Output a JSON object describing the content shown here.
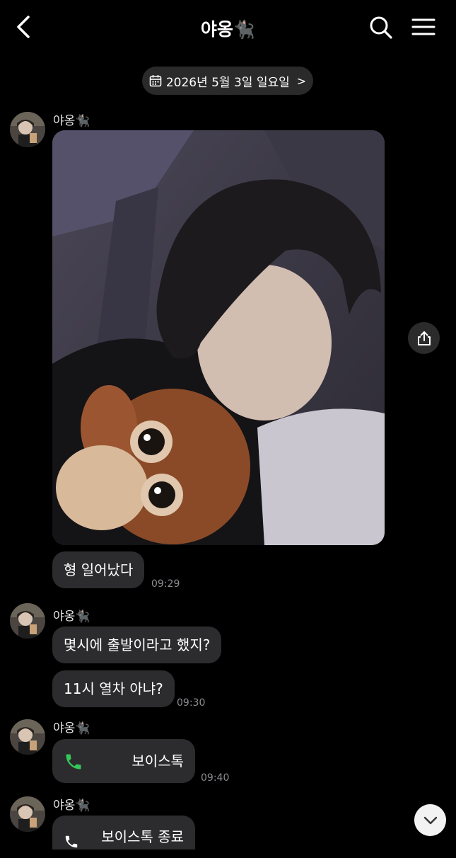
{
  "header": {
    "title": "야옹🐈‍⬛"
  },
  "date_divider": {
    "text": "2026년 5월 3일 일요일",
    "chevron": ">"
  },
  "messages": {
    "group1": {
      "sender": "야옹🐈‍⬛",
      "text": "형 일어났다",
      "time": "09:29"
    },
    "group2": {
      "sender": "야옹🐈‍⬛",
      "text1": "몇시에 출발이라고 했지?",
      "text2": "11시 열차 아냐?",
      "time": "09:30"
    },
    "group3": {
      "sender": "야옹🐈‍⬛",
      "voice_label": "보이스톡",
      "time": "09:40"
    },
    "group4": {
      "sender": "야옹🐈‍⬛",
      "voice_label": "보이스톡 종료"
    }
  },
  "icons": {
    "back": "chevron-left-icon",
    "search": "search-icon",
    "menu": "hamburger-menu-icon",
    "calendar": "calendar-icon",
    "share": "share-icon",
    "phone": "phone-icon",
    "scroll_down": "chevron-down-icon"
  },
  "colors": {
    "background": "#000000",
    "bubble": "#2c2c2e",
    "phone_green": "#34c759",
    "timestamp": "#8e8e93"
  }
}
